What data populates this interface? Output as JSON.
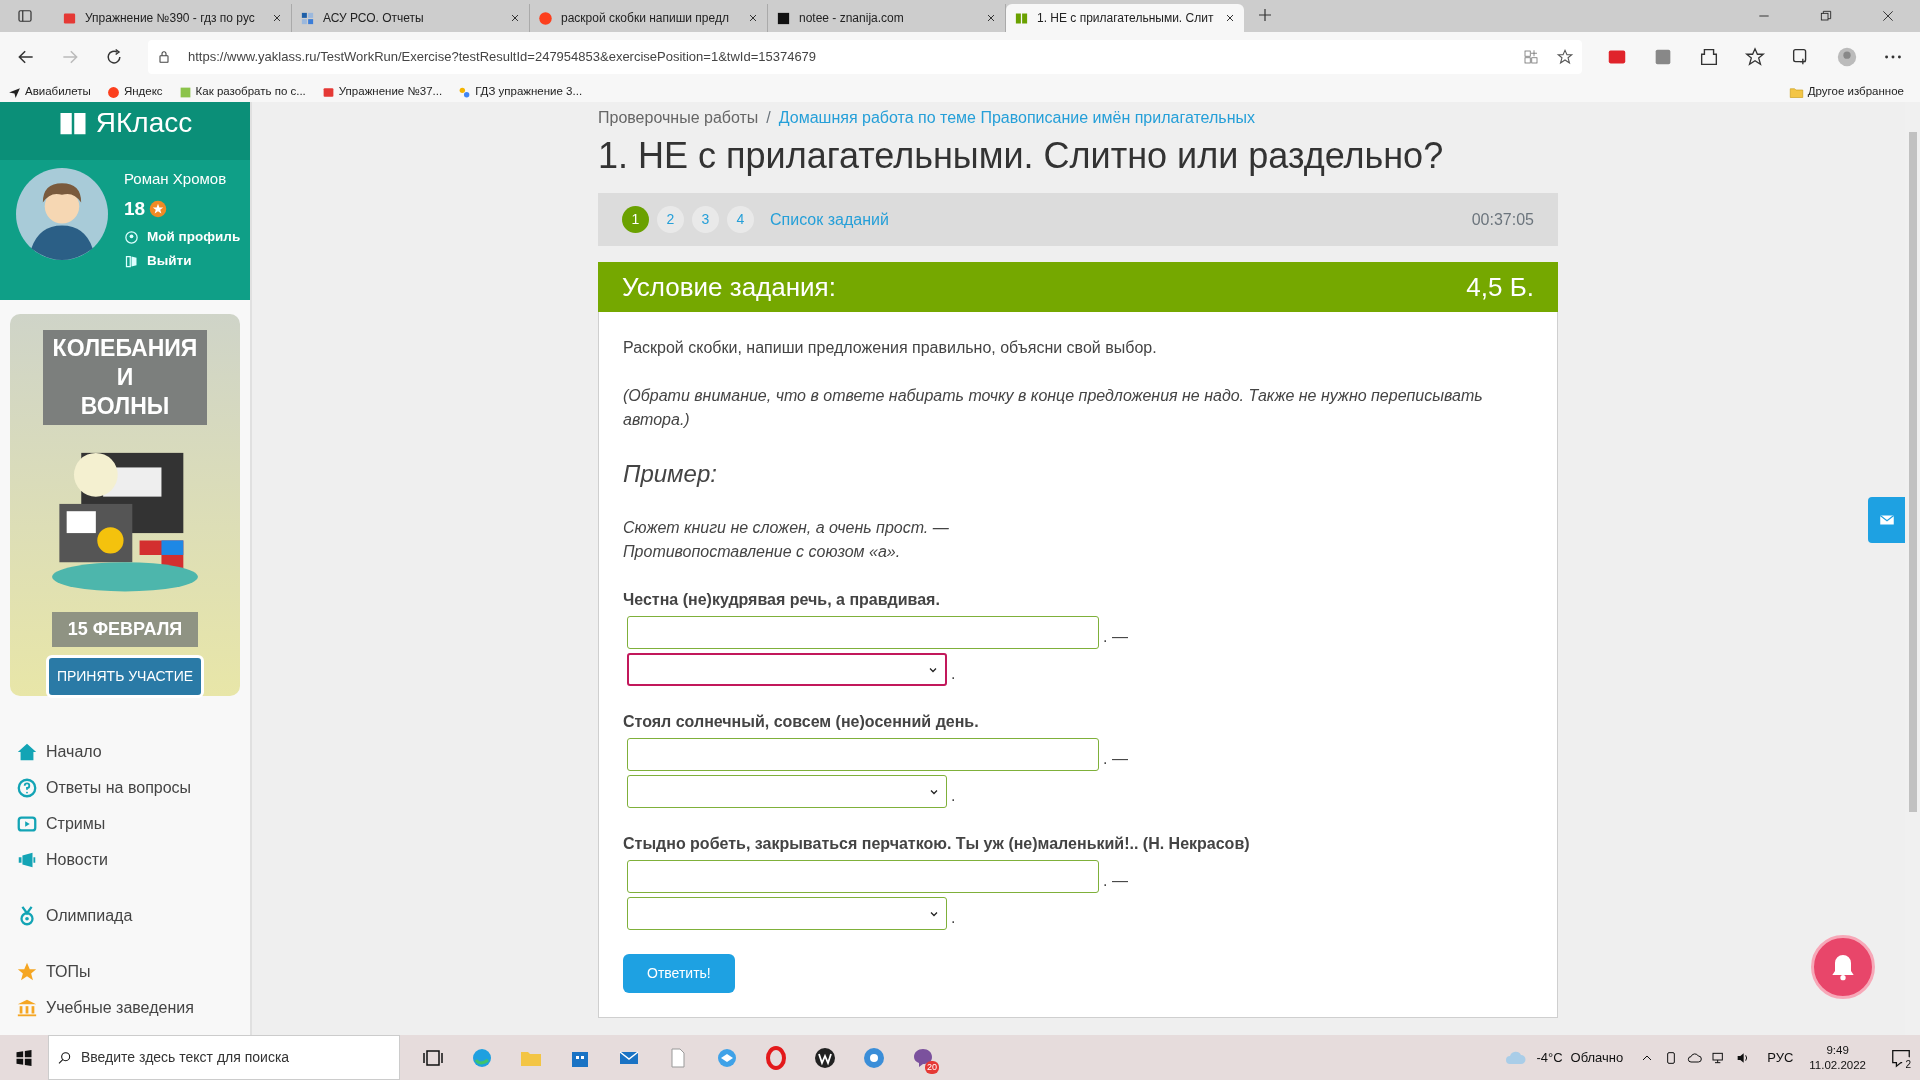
{
  "browser": {
    "tabs": [
      {
        "title": "Упражнение №390 - гдз по рус",
        "selected": false
      },
      {
        "title": "АСУ РСО. Отчеты",
        "selected": false
      },
      {
        "title": "раскрой скобки напиши предл",
        "selected": false
      },
      {
        "title": "notee - znanija.com",
        "selected": false
      },
      {
        "title": "1. НЕ с прилагательными. Слит",
        "selected": true
      }
    ],
    "address": "https://www.yaklass.ru/TestWorkRun/Exercise?testResultId=247954853&exercisePosition=1&twId=15374679",
    "bookmarks": [
      "Авиабилеты",
      "Яндекс",
      "Как разобрать по с...",
      "Упражнение №37...",
      "ГДЗ упражнение 3..."
    ],
    "other_bookmarks": "Другое избранное"
  },
  "sidebar": {
    "logo": "ЯКласс",
    "user_name": "Роман Хромов",
    "points": "18",
    "profile_links": [
      "Мой профиль",
      "Выйти"
    ],
    "banner": {
      "title_lines": [
        "КОЛЕБАНИЯ",
        "И",
        "ВОЛНЫ"
      ],
      "date": "15 ФЕВРАЛЯ",
      "button": "ПРИНЯТЬ УЧАСТИЕ"
    },
    "nav": [
      {
        "label": "Начало"
      },
      {
        "label": "Ответы на вопросы"
      },
      {
        "label": "Стримы"
      },
      {
        "label": "Новости"
      },
      {
        "label": "Олимпиада"
      },
      {
        "label": "ТОПы"
      },
      {
        "label": "Учебные заведения"
      }
    ]
  },
  "breadcrumb_separator": "/",
  "breadcrumb": [
    "Проверочные работы",
    "Домашняя работа по теме Правописание имён прилагательных"
  ],
  "title": "1. НЕ с прилагательными. Слитно или раздельно?",
  "task_nav": {
    "steps": [
      {
        "label": "1",
        "selected": true
      },
      {
        "label": "2",
        "selected": false
      },
      {
        "label": "3",
        "selected": false
      },
      {
        "label": "4",
        "selected": false
      }
    ],
    "list_link": "Список заданий",
    "timer": "00:37:05"
  },
  "condition": {
    "heading": "Условие задания:",
    "points": "4,5 Б.",
    "instruction": "Раскрой скобки, напиши предложения правильно, объясни свой выбор.",
    "note": "(Обрати внимание, что в ответе набирать точку в конце предложения не надо. Также не нужно переписывать автора.)",
    "example_heading": "Пример:",
    "example_lines": [
      "Сюжет книги не сложен, а очень прост. —",
      "Противопоставление с союзом «а»."
    ],
    "questions": [
      {
        "text": "Честна (не)кудрявая речь, а правдивая.",
        "separator": ". —",
        "end": ".",
        "select_focused": true
      },
      {
        "text": "Стоял солнечный, совсем (не)осенний день.",
        "separator": ". —",
        "end": ".",
        "select_focused": false
      },
      {
        "text": "Стыдно робеть, закрываться перчаткою. Ты уж (не)маленький!.. (Н. Некрасов)",
        "separator": ". —",
        "end": ".",
        "select_focused": false
      }
    ],
    "submit": "Ответить!"
  },
  "taskbar": {
    "search_placeholder": "Введите здесь текст для поиска",
    "viber_badge": "20",
    "temperature": "-4°C",
    "weather": "Облачно",
    "language": "РУС",
    "time": "9:49",
    "date": "11.02.2022",
    "notifications": "2"
  }
}
